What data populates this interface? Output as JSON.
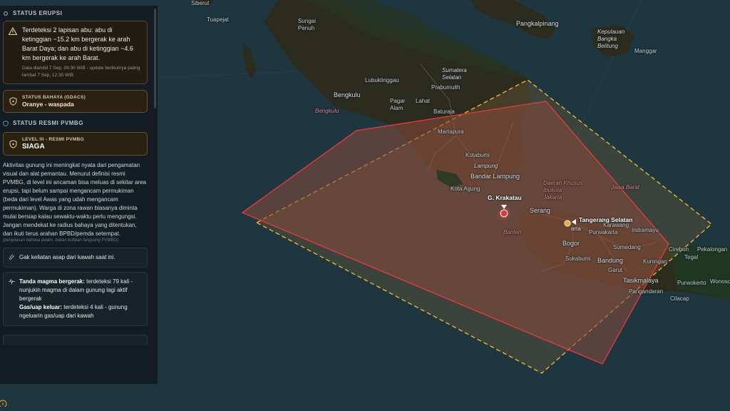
{
  "map": {
    "colors": {
      "sea": "#1d3640",
      "land": "#2b2a1e",
      "zone_fill": "#7a4a34",
      "zone_stroke": "#e23a3a",
      "dash_stroke": "#f0b429",
      "marker": "#e23a3a",
      "aoi": "#f6a623"
    },
    "labels": {
      "siberut": "Siberut",
      "tuapejat": "Tuapejat",
      "sungai_penuh": "Sungai\nPenuh",
      "pangkalpinang": "Pangkalpinang",
      "kepulauan_bangka_belitung": "Kepulauan\nBangka\nBelitung",
      "manggar": "Manggar",
      "bengkulu_city": "Bengkulu",
      "lubuklinggau": "Lubuklinggau",
      "sumatera_selatan": "Sumatera\nSelatan",
      "prabumulih": "Prabumulih",
      "pagar_alam": "Pagar\nAlam",
      "lahat": "Lahat",
      "baturaja": "Baturaja",
      "bengkulu_prov": "Bengkulu",
      "martapura": "Martapura",
      "kotabumi": "Kotabumi",
      "lampung": "Lampung",
      "bandar_lampung": "Bandar Lampung",
      "kota_agung": "Kota Agung",
      "g_krakatau": "G. Krakatau",
      "dki_jakarta": "Daerah Khusus\nIbukota\nJakarta",
      "jawa_barat": "Jawa Barat",
      "serang": "Serang",
      "tangerang_selatan": "Tangerang Selatan",
      "jakarta": "arta",
      "banten": "Banten",
      "karawang": "Karawang",
      "purwakarta": "Purwakarta",
      "indramayu": "Indramayu",
      "cirebon": "Cirebon",
      "pekalongan": "Pekalongan",
      "tegal": "Tegal",
      "bogor": "Bogor",
      "sumedang": "Sumedang",
      "kuningan": "Kuningan",
      "sukabumi": "Sukabumi",
      "bandung": "Bandung",
      "garut": "Garut",
      "tasikmalaya": "Tasikmalaya",
      "purwokerto": "Purwokerto",
      "wonoso": "Wonoso",
      "pangandaran": "Pangandaran",
      "cilacap": "Cilacap"
    }
  },
  "panel": {
    "erupsi_title": "STATUS ERUPSI",
    "erupsi_text": "Terdeteksi 2 lapisan abu: abu di ketinggian ~15.2 km bergerak ke arah Barat Daya; dan abu di ketinggian ~4.6 km bergerak ke arah Barat.",
    "erupsi_meta": "Data diambil 7 Sep, 09:30 WIB - update berikutnya paling lambat 7 Sep, 12:30 WIB",
    "bahaya_cap": "STATUS BAHAYA (GDACS)",
    "bahaya_val": "Oranye - waspada",
    "pvmbg_title": "STATUS RESMI PVMBG",
    "level_cap": "LEVEL III - RESMI PVMBG",
    "level_val": "SIAGA",
    "desc": "Aktivitas gunung ini meningkat nyata dari pengamatan visual dan alat pemantau. Menurut definisi resmi PVMBG, di level ini ancaman bisa meluas di sekitar area erupsi, tapi belum sampai mengancam permukiman (beda dari level Awas yang udah mengancam permukiman). Warga di zona rawan biasanya diminta mulai bersiap kalau sewaktu-waktu perlu mengungsi. Jangan mendekat ke radius bahaya yang ditentukan, dan ikuti terus arahan BPBD/pemda setempat.",
    "note": "(penjelasan bahasa awam, bukan kutipan langsung PVMBG)",
    "smoke_text": "Gak keliatan asap dari kawah saat ini.",
    "magma_label": "Tanda magma bergerak:",
    "magma_text": " terdeteksi 79 kali - nunjukin magma di dalam gunung lagi aktif bergerak",
    "gas_label": "Gas/uap keluar:",
    "gas_text": " terdeteksi 4 kali - gunung ngeluarin gas/uap dari kawah"
  }
}
